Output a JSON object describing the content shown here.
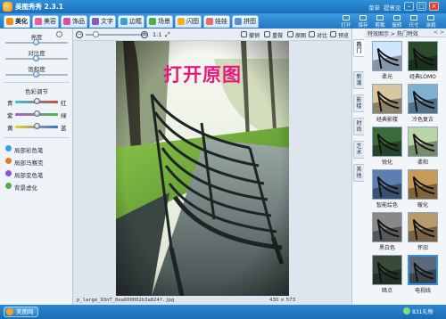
{
  "app": {
    "title": "美图秀秀 2.3.1",
    "menu": [
      "菜单",
      "提意见"
    ]
  },
  "tabs": [
    {
      "label": "美化",
      "color": "#f28c1a"
    },
    {
      "label": "美容",
      "color": "#e85d9a"
    },
    {
      "label": "饰品",
      "color": "#d64fa0"
    },
    {
      "label": "文字",
      "color": "#8a59c8"
    },
    {
      "label": "边框",
      "color": "#3aa0d8"
    },
    {
      "label": "场景",
      "color": "#4cae4c"
    },
    {
      "label": "闪图",
      "color": "#f2b01e"
    },
    {
      "label": "娃娃",
      "color": "#e86a6a"
    },
    {
      "label": "拼图",
      "color": "#5b8fd9"
    }
  ],
  "toolbar_right": [
    "打开",
    "保存",
    "剪裁",
    "旋转",
    "尺寸",
    "涂鸦"
  ],
  "adjust": {
    "brightness": {
      "label": "亮度",
      "value": 0.5
    },
    "contrast": {
      "label": "对比度",
      "value": 0.5
    },
    "saturation": {
      "label": "饱和度",
      "value": 0.5
    },
    "color_title": "色彩调节",
    "color_rows": [
      {
        "left": "青",
        "right": "红",
        "gradient": "linear-gradient(90deg,#30c7d8,#e04141)"
      },
      {
        "left": "紫",
        "right": "绿",
        "gradient": "linear-gradient(90deg,#b05ad0,#43c24a)"
      },
      {
        "left": "黄",
        "right": "蓝",
        "gradient": "linear-gradient(90deg,#f0d021,#2f6fe0)"
      }
    ]
  },
  "effects": [
    {
      "label": "局部彩色笔",
      "color": "#3aa0d8"
    },
    {
      "label": "局部马赛克",
      "color": "#e07a2a"
    },
    {
      "label": "局部变色笔",
      "color": "#8a59c8"
    },
    {
      "label": "背景虚化",
      "color": "#4cae4c"
    }
  ],
  "canvas": {
    "zoom_reset": "1:1",
    "actions": [
      "撤销",
      "重做",
      "原图",
      "对比",
      "预览"
    ],
    "overlay_text": "打开原图",
    "filename": "p_large_93nT_0ea600002b3a824f.jpg",
    "dimensions": "430 × 573"
  },
  "right_panel": {
    "breadcrumb": "特效图示 > 热门特效",
    "arrows": "< >",
    "vertical_tabs": [
      "热门",
      "新潮",
      "影楼",
      "时尚",
      "艺术",
      "其他"
    ],
    "filters": [
      {
        "label": "柔光",
        "tint": "#cfe6ff",
        "selected": false
      },
      {
        "label": "经典LOMO",
        "tint": "#2a4a2a",
        "selected": false
      },
      {
        "label": "经典影楼",
        "tint": "#d9c7a0",
        "selected": false
      },
      {
        "label": "冷色复古",
        "tint": "#7fb0d0",
        "selected": false
      },
      {
        "label": "锐化",
        "tint": "#3b6b3b",
        "selected": false
      },
      {
        "label": "柔和",
        "tint": "#b8d6a8",
        "selected": false
      },
      {
        "label": "智能绘色",
        "tint": "#5a7fb0",
        "selected": false
      },
      {
        "label": "暖化",
        "tint": "#c89a5a",
        "selected": false
      },
      {
        "label": "黑白色",
        "tint": "#888888",
        "selected": false
      },
      {
        "label": "怀旧",
        "tint": "#b99a6a",
        "selected": false
      },
      {
        "label": "暗点",
        "tint": "#3a4a3a",
        "selected": false
      },
      {
        "label": "电视线",
        "tint": "#5a6a7a",
        "selected": true
      }
    ]
  },
  "bottom": {
    "home_label": "美图网",
    "tray_label": "831礼物"
  }
}
